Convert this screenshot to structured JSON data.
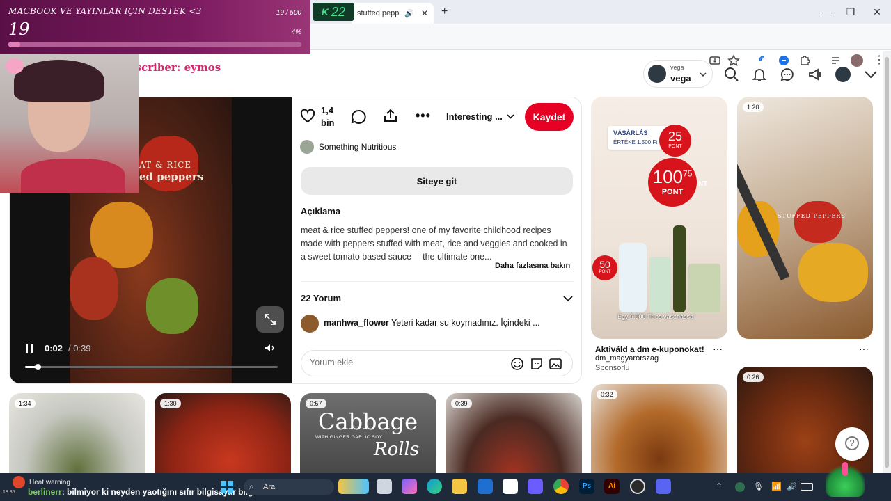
{
  "stream": {
    "donation_title": "MACBOOK VE YAYINLAR IÇIN DESTEK <3",
    "donation_amount": "19",
    "donation_goal": "19 / 500",
    "donation_percent": "4%",
    "donation_progress": 0.04,
    "timer_value": "22",
    "last_subscriber": "Last subscriber: eymos",
    "chat_username": "berlinerr",
    "chat_message": ": bilmiyor ki neyden yaotığını sıfır bilgisayar bilgisi",
    "heat_warning": "Heat warning"
  },
  "browser": {
    "tab_title": "stuffed pepper",
    "new_tab_icon": "plus-icon"
  },
  "header": {
    "user_label": "vega",
    "user_name": "vega"
  },
  "pin": {
    "likes": "1,4",
    "likes_unit": "bin",
    "board_select": "Interesting ...",
    "save_label": "Kaydet",
    "creator": "Something Nutritious",
    "visit_label": "Siteye git",
    "description_title": "Açıklama",
    "description": "meat & rice stuffed peppers! one of my favorite childhood recipes made with peppers stuffed with meat, rice and veggies and cooked in a sweet tomato based sauce— the ultimate one...",
    "more_link": "Daha fazlasına bakın",
    "comments_count": "22 Yorum",
    "comment_user": "manhwa_flower",
    "comment_text": "Yeteri kadar su koymadınız. İçindeki ...",
    "comment_placeholder": "Yorum ekle",
    "video_time_current": "0:02",
    "video_time_total": "/ 0:39",
    "video_progress": 0.05,
    "video_overlay_line1": "AT & RICE",
    "video_overlay_line2": "ed peppers"
  },
  "grid": {
    "ad": {
      "badge_line1": "VÁSÁRLÁS",
      "badge_line2": "ÉRTÉKE  1.500 Ft",
      "pont25": "25",
      "pont_label": "PONT",
      "pont100": "100",
      "pont100_sup": "75",
      "pont100_nt": "NT",
      "pont50": "50",
      "footer": "Egy 9.000 Ft-os vásárlással",
      "title": "Aktiváld a dm e-kuponokat!",
      "advertiser": "dm_magyarorszag",
      "sponsored": "Sponsorlu"
    },
    "stuffed_overlay": "STUFFED PEPPERS",
    "tiles": [
      {
        "duration": "1:20"
      },
      {
        "duration": "1:34"
      },
      {
        "duration": "1:30"
      },
      {
        "duration": "0:57",
        "title": "Cabbage",
        "subtitle": "WITH GINGER GARLIC SOY",
        "script": "Rolls"
      },
      {
        "duration": "0:39"
      },
      {
        "duration": "0:32"
      },
      {
        "duration": "0:26"
      }
    ]
  },
  "taskbar": {
    "search_label": "Ara",
    "clock": "18:35"
  }
}
